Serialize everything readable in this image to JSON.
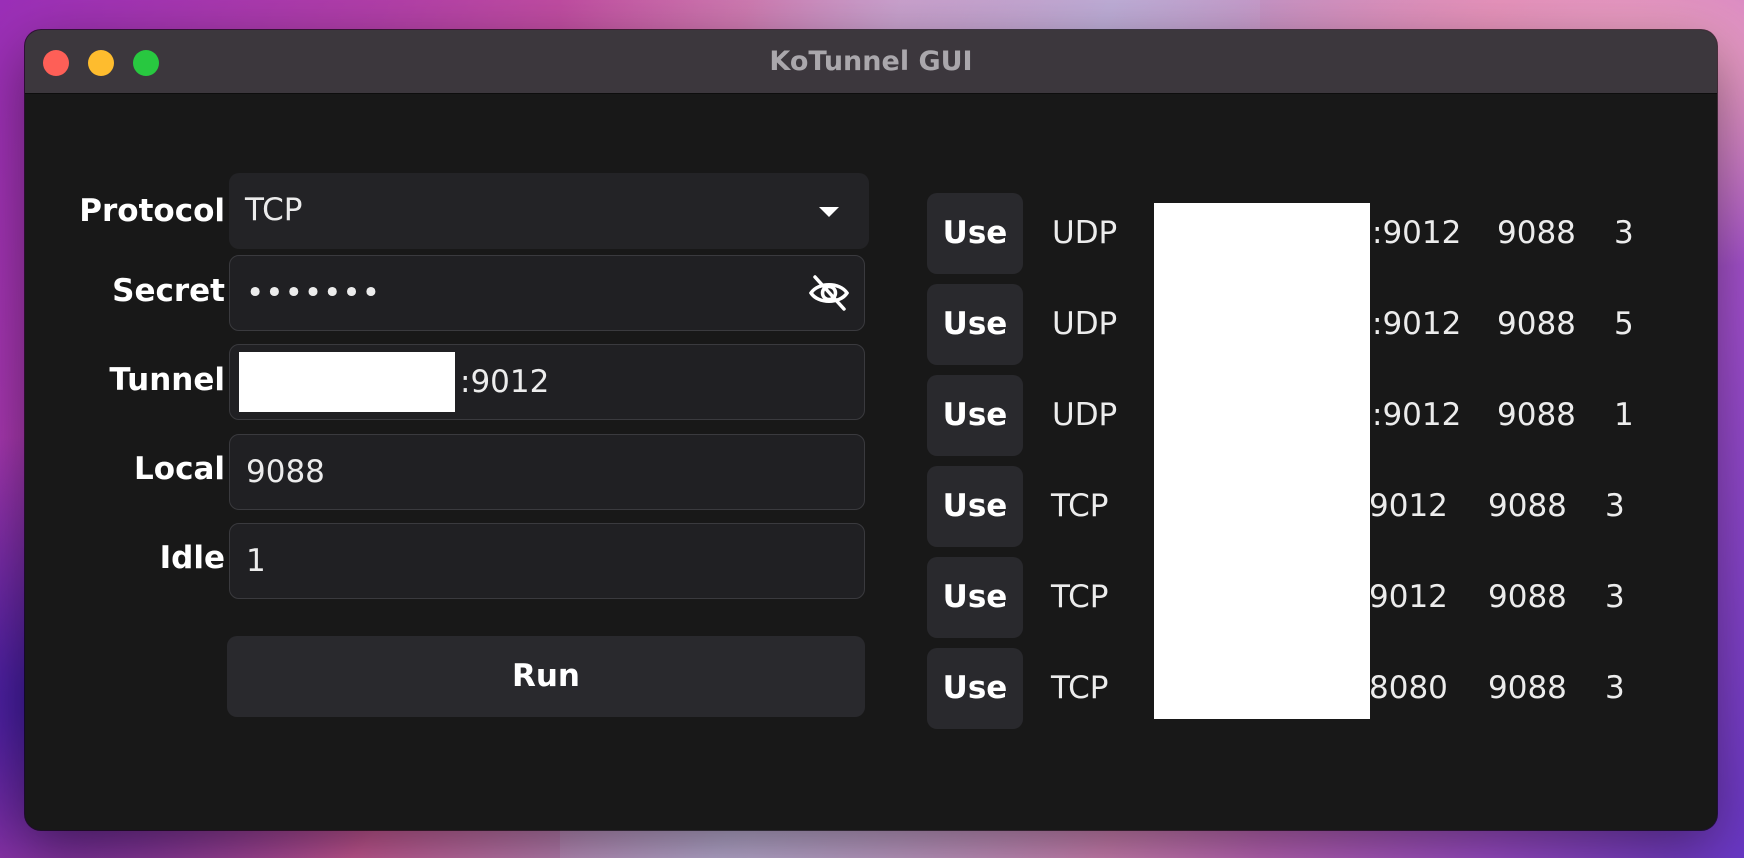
{
  "window": {
    "title": "KoTunnel GUI"
  },
  "form": {
    "protocol": {
      "label": "Protocol",
      "value": "TCP"
    },
    "secret": {
      "label": "Secret",
      "value": "•••••••"
    },
    "tunnel": {
      "label": "Tunnel",
      "value_suffix": ":9012"
    },
    "local": {
      "label": "Local",
      "value": "9088"
    },
    "idle": {
      "label": "Idle",
      "value": "1"
    },
    "run_label": "Run"
  },
  "history": {
    "use_label": "Use",
    "rows": [
      {
        "protocol": "UDP",
        "tunnel_port": ":9012",
        "local": "9088",
        "idle": "3"
      },
      {
        "protocol": "UDP",
        "tunnel_port": ":9012",
        "local": "9088",
        "idle": "5"
      },
      {
        "protocol": "UDP",
        "tunnel_port": ":9012",
        "local": "9088",
        "idle": "1"
      },
      {
        "protocol": "TCP",
        "tunnel_port": "9012",
        "local": "9088",
        "idle": "3"
      },
      {
        "protocol": "TCP",
        "tunnel_port": "9012",
        "local": "9088",
        "idle": "3"
      },
      {
        "protocol": "TCP",
        "tunnel_port": "8080",
        "local": "9088",
        "idle": "3"
      }
    ]
  },
  "colors": {
    "window_bg": "#181818",
    "titlebar_bg": "#3c373d",
    "button_bg": "#29292d",
    "field_bg": "#202023",
    "close": "#fe5f57",
    "minimize": "#febc2e",
    "maximize": "#28c840"
  }
}
